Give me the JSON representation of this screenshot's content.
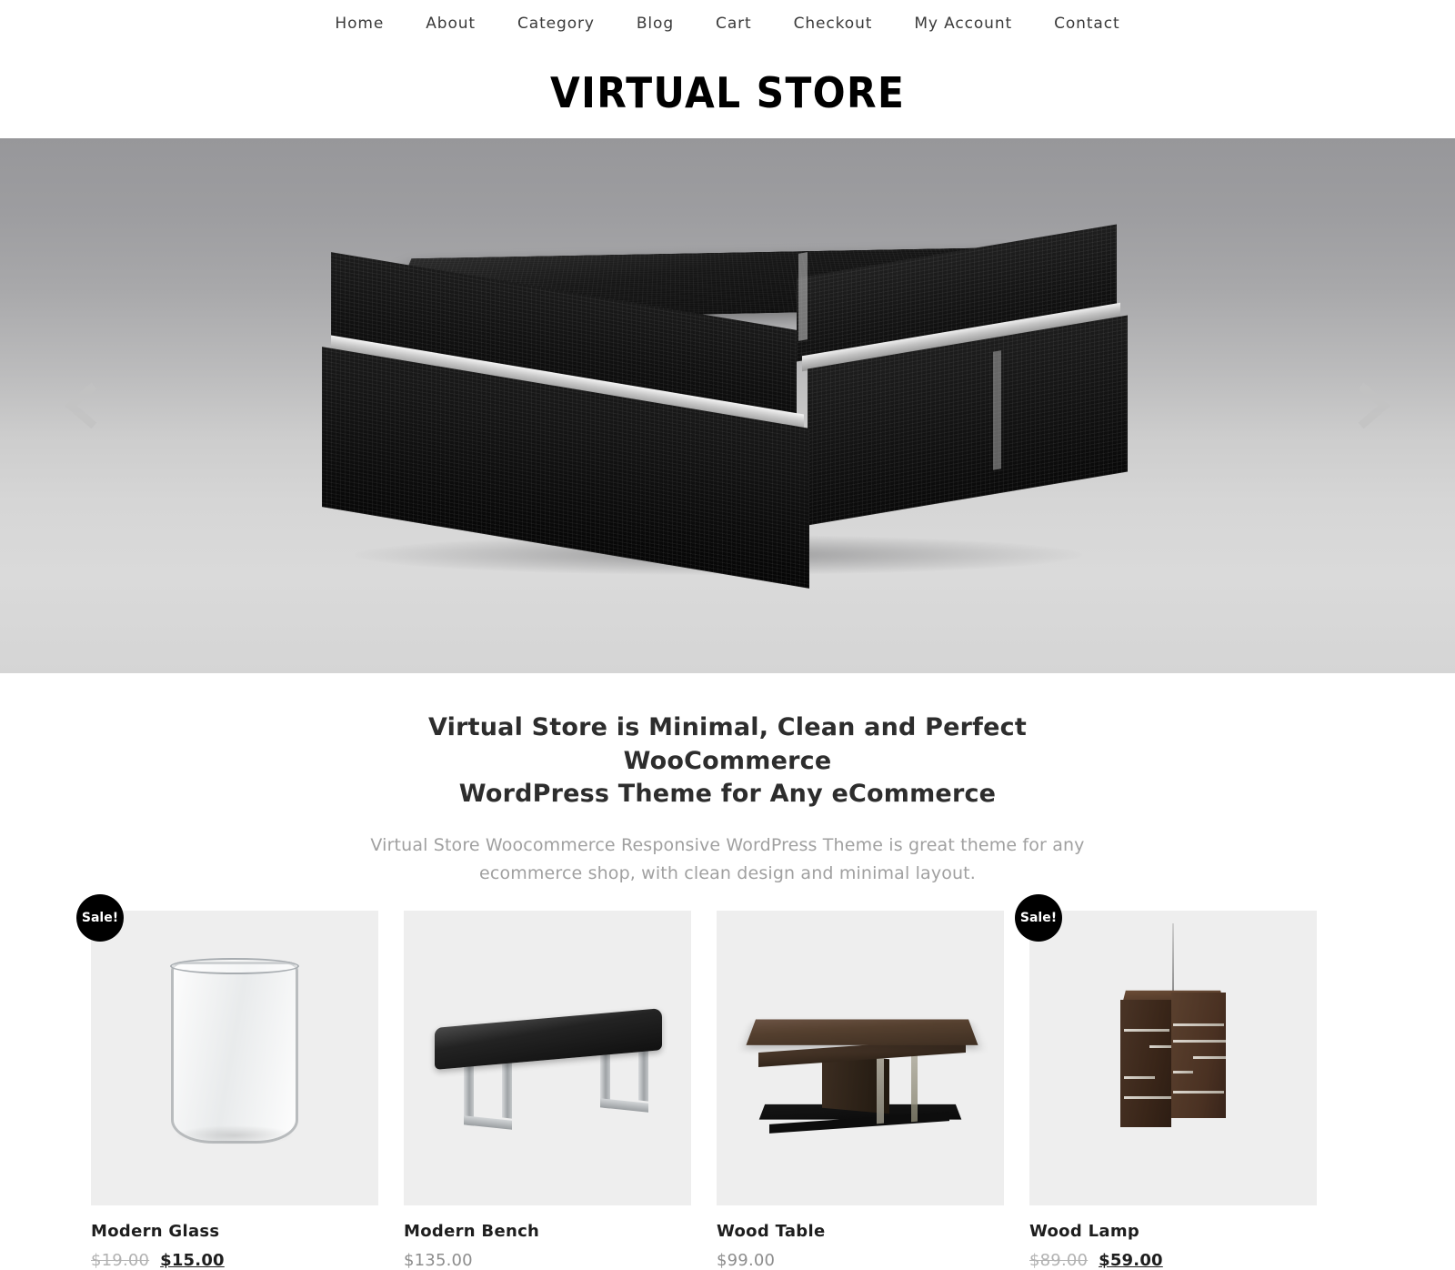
{
  "nav": {
    "items": [
      {
        "label": "Home"
      },
      {
        "label": "About"
      },
      {
        "label": "Category"
      },
      {
        "label": "Blog"
      },
      {
        "label": "Cart"
      },
      {
        "label": "Checkout"
      },
      {
        "label": "My Account"
      },
      {
        "label": "Contact"
      }
    ]
  },
  "brand": {
    "logo": "VIRTUAL STORE"
  },
  "hero": {
    "prev_icon": "chevron-left-icon",
    "next_icon": "chevron-right-icon",
    "slide_alt": "Black crocodile-texture coffee table with chrome trim",
    "background_top_color": "#97979a",
    "background_bottom_color": "#d8d8d8"
  },
  "promo": {
    "title_line1": "Virtual Store is Minimal, Clean and Perfect WooCommerce",
    "title_line2": "WordPress Theme for Any eCommerce",
    "subtitle_line1": "Virtual Store Woocommerce Responsive WordPress Theme is great theme for any",
    "subtitle_line2": "ecommerce shop, with clean design and minimal layout."
  },
  "products": [
    {
      "name": "Modern Glass",
      "on_sale": true,
      "sale_label": "Sale!",
      "old_price": "$19.00",
      "price": "$15.00",
      "image_alt": "Curved clear drinking glass"
    },
    {
      "name": "Modern Bench",
      "on_sale": false,
      "sale_label": "",
      "old_price": "",
      "price": "$135.00",
      "image_alt": "Black leather bench with chrome legs"
    },
    {
      "name": "Wood Table",
      "on_sale": false,
      "sale_label": "",
      "old_price": "",
      "price": "$99.00",
      "image_alt": "Dark wood coffee table with black base"
    },
    {
      "name": "Wood Lamp",
      "on_sale": true,
      "sale_label": "Sale!",
      "old_price": "$89.00",
      "price": "$59.00",
      "image_alt": "Walnut pendant lamp with horizontal slits"
    }
  ],
  "colors": {
    "accent": "#000000",
    "text": "#1e1e1e",
    "muted": "#8d8d8d",
    "thumb_bg": "#eeeeee"
  }
}
